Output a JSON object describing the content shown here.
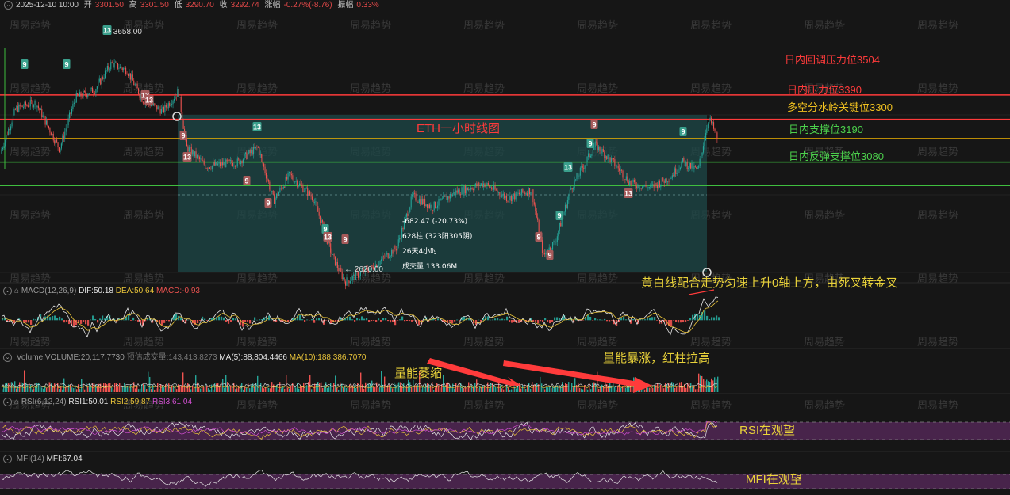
{
  "header": {
    "datetime": "2025-12-10 10:00",
    "open_label": "开",
    "open": "3301.50",
    "high_label": "高",
    "high": "3301.50",
    "low_label": "低",
    "low": "3290.70",
    "close_label": "收",
    "close": "3292.74",
    "change_label": "涨幅",
    "change": "-0.27%(-8.76)",
    "amplitude_label": "振幅",
    "amplitude": "0.33%"
  },
  "chart_data": {
    "type": "line",
    "title": "ETH一小时线图",
    "y_range": [
      2540,
      3760
    ],
    "price_marks": {
      "high": "3658.00",
      "low": "2620.00"
    },
    "levels": [
      {
        "label": "日内回调压力位3504",
        "value": 3504,
        "color": "#ff3b3b"
      },
      {
        "label": "日内压力位3390",
        "value": 3390,
        "color": "#ff3b3b"
      },
      {
        "label": "多空分水岭关键位3300",
        "value": 3300,
        "color": "#f0b400"
      },
      {
        "label": "日内支撑位3190",
        "value": 3190,
        "color": "#3fbf3f"
      },
      {
        "label": "日内反弹支撑位3080",
        "value": 3080,
        "color": "#3fbf3f"
      }
    ],
    "measure": {
      "change": "-682.47 (-20.73%)",
      "bars": "628柱 (323阳305阴)",
      "duration": "26天4小时",
      "volume": "成交量 133.06M"
    },
    "td_markers": [
      {
        "label": "9",
        "color": "green"
      },
      {
        "label": "9",
        "color": "green"
      },
      {
        "label": "13",
        "color": "green"
      },
      {
        "label": "13",
        "color": "red"
      },
      {
        "label": "13",
        "color": "red"
      },
      {
        "label": "9",
        "color": "red"
      },
      {
        "label": "13",
        "color": "red"
      },
      {
        "label": "13",
        "color": "green"
      },
      {
        "label": "9",
        "color": "red"
      },
      {
        "label": "9",
        "color": "red"
      },
      {
        "label": "9",
        "color": "green"
      },
      {
        "label": "13",
        "color": "red"
      },
      {
        "label": "9",
        "color": "red"
      },
      {
        "label": "9",
        "color": "red"
      },
      {
        "label": "9",
        "color": "red"
      },
      {
        "label": "9",
        "color": "green"
      },
      {
        "label": "13",
        "color": "green"
      },
      {
        "label": "9",
        "color": "green"
      },
      {
        "label": "9",
        "color": "red"
      },
      {
        "label": "13",
        "color": "red"
      },
      {
        "label": "9",
        "color": "green"
      }
    ]
  },
  "indicators": {
    "macd": {
      "name": "MACD(12,26,9)",
      "dif": "DIF:50.18",
      "dea": "DEA:50.64",
      "macd": "MACD:-0.93"
    },
    "volume": {
      "name": "Volume",
      "volume": "VOLUME:20,117.7730",
      "est": "预估成交量:143,413.8273",
      "ma5": "MA(5):88,804.4466",
      "ma10": "MA(10):188,386.7070"
    },
    "rsi": {
      "name": "RSI(6,12,24)",
      "rsi1": "RSI1:50.01",
      "rsi2": "RSI2:59.87",
      "rsi3": "RSI3:61.04"
    },
    "mfi": {
      "name": "MFI(14)",
      "mfi": "MFI:67.04"
    }
  },
  "annotations": {
    "macd_note": "黄白线配合走势匀速上升0轴上方，由死叉转金叉",
    "vol_shrink": "量能萎缩",
    "vol_surge": "量能暴涨，红柱拉高",
    "rsi_note": "RSI在观望",
    "mfi_note": "MFI在观望"
  },
  "watermark": "周易趋势",
  "colors": {
    "up": "#26a69a",
    "down": "#ef5350",
    "yellow": "#e9c43a",
    "white": "#e6e6e6",
    "purple": "#5a2a5e",
    "box": "#1f4a4a"
  }
}
